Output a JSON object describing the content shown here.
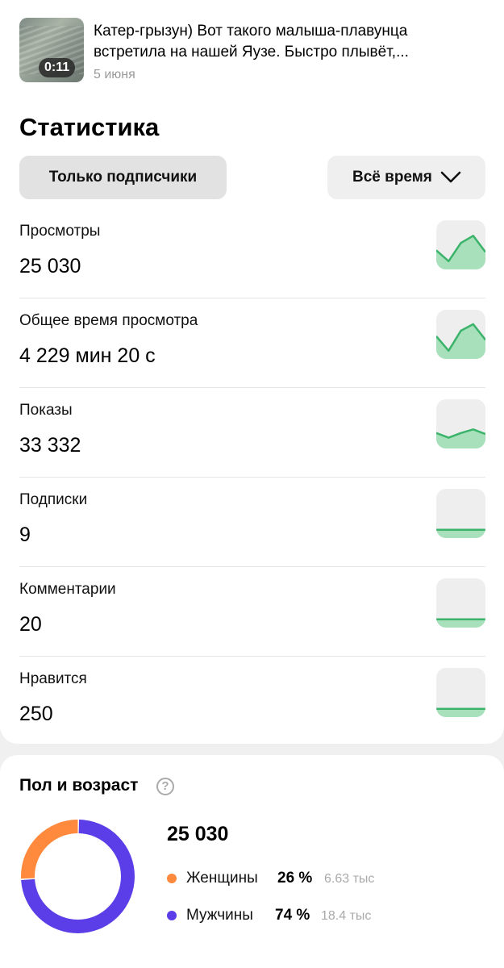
{
  "video": {
    "duration": "0:11",
    "title_line1": "Катер-грызун) Вот такого малыша-плавунца",
    "title_line2": "встретила на нашей Яузе. Быстро плывёт,...",
    "date": "5 июня"
  },
  "stats": {
    "title": "Статистика",
    "filter_audience": "Только подписчики",
    "filter_period": "Всё время"
  },
  "metrics": [
    {
      "label": "Просмотры",
      "value": "25 030",
      "trend": [
        0.35,
        0.05,
        0.55,
        0.75,
        0.3
      ]
    },
    {
      "label": "Общее время просмотра",
      "value": "4 229 мин 20 с",
      "trend": [
        0.45,
        0.05,
        0.6,
        0.78,
        0.35
      ]
    },
    {
      "label": "Показы",
      "value": "33 332",
      "trend": [
        0.25,
        0.12,
        0.25,
        0.35,
        0.22
      ]
    },
    {
      "label": "Подписки",
      "value": "9",
      "trend": [
        0.05,
        0.05,
        0.05,
        0.05,
        0.05
      ]
    },
    {
      "label": "Комментарии",
      "value": "20",
      "trend": [
        0.05,
        0.05,
        0.05,
        0.05,
        0.05
      ]
    },
    {
      "label": "Нравится",
      "value": "250",
      "trend": [
        0.05,
        0.05,
        0.05,
        0.05,
        0.05
      ]
    }
  ],
  "demographics": {
    "title": "Пол и возраст",
    "help_icon": "question-circle-icon",
    "total": "25 030",
    "segments": [
      {
        "name": "Женщины",
        "pct": "26 %",
        "share": 0.26,
        "abs": "6.63 тыс",
        "color": "#ff8a3d"
      },
      {
        "name": "Мужчины",
        "pct": "74 %",
        "share": 0.74,
        "abs": "18.4 тыс",
        "color": "#5b3ee8"
      }
    ]
  },
  "colors": {
    "spark_line": "#3bb36a",
    "spark_fill": "#a8e0bb"
  }
}
